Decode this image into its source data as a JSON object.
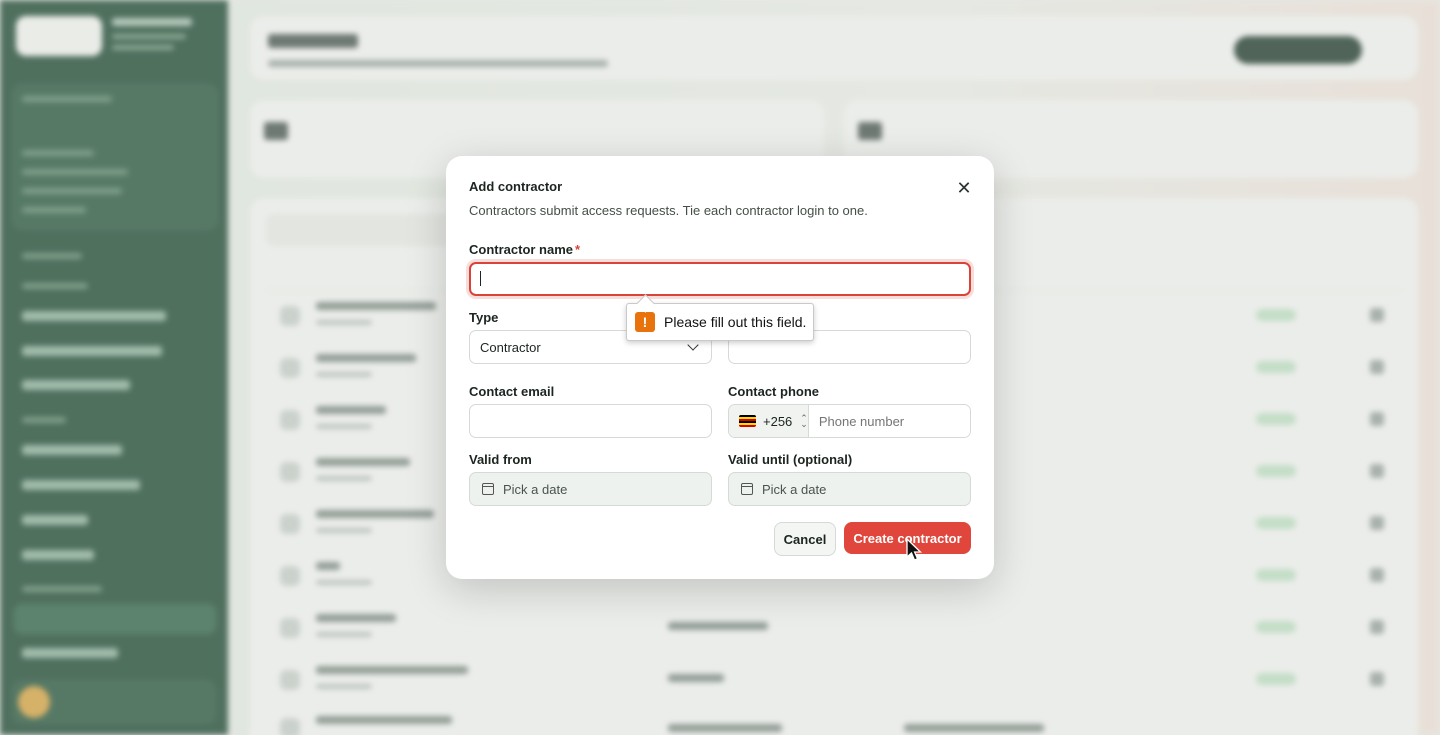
{
  "modal": {
    "title": "Add contractor",
    "description": "Contractors submit access requests. Tie each contractor login to one.",
    "close_icon": "close-icon",
    "fields": {
      "contractor_name": {
        "label": "Contractor name",
        "required_marker": "*",
        "value": ""
      },
      "type": {
        "label": "Type",
        "selected": "Contractor"
      },
      "registration": {
        "value": ""
      },
      "contact_email": {
        "label": "Contact email",
        "value": ""
      },
      "contact_phone": {
        "label": "Contact phone",
        "country_code": "+256",
        "placeholder": "Phone number",
        "value": ""
      },
      "valid_from": {
        "label": "Valid from",
        "placeholder": "Pick a date"
      },
      "valid_until": {
        "label": "Valid until (optional)",
        "placeholder": "Pick a date"
      }
    },
    "buttons": {
      "cancel": "Cancel",
      "create": "Create contractor"
    }
  },
  "validation_tooltip": {
    "message": "Please fill out this field.",
    "icon": "!"
  },
  "colors": {
    "primary": "#e0463b",
    "error": "#d9443a",
    "sidebar": "#1f4a33",
    "tooltip_icon": "#e8720c"
  },
  "icons": {
    "flag": "uganda-flag-icon",
    "calendar": "calendar-icon",
    "chevron": "chevron-down-icon",
    "warning": "warning-icon"
  }
}
